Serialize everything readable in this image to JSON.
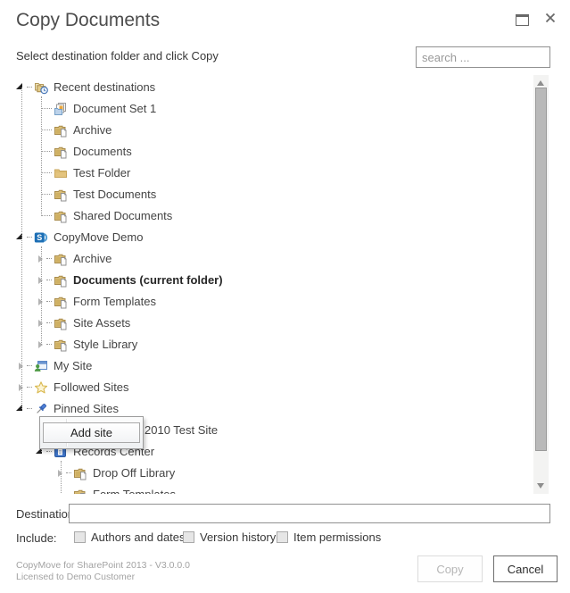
{
  "window": {
    "title": "Copy Documents",
    "controls": [
      {
        "name": "maximize",
        "icon": "maximize-icon"
      },
      {
        "name": "close",
        "icon": "close-icon"
      }
    ]
  },
  "instruction": "Select destination folder and click Copy",
  "search": {
    "placeholder": "search ..."
  },
  "tree": {
    "items": [
      {
        "label": "Recent destinations",
        "level": 0,
        "icon": "recent-destinations",
        "glyph": "expanded"
      },
      {
        "label": "Document Set 1",
        "level": 1,
        "icon": "document-set",
        "glyph": "none"
      },
      {
        "label": "Archive",
        "level": 1,
        "icon": "document-library",
        "glyph": "none"
      },
      {
        "label": "Documents",
        "level": 1,
        "icon": "document-library",
        "glyph": "none"
      },
      {
        "label": "Test Folder",
        "level": 1,
        "icon": "folder",
        "glyph": "none"
      },
      {
        "label": "Test Documents",
        "level": 1,
        "icon": "document-library",
        "glyph": "none"
      },
      {
        "label": "Shared Documents",
        "level": 1,
        "icon": "document-library",
        "glyph": "none"
      },
      {
        "label": "CopyMove Demo",
        "level": 0,
        "icon": "sharepoint-site",
        "glyph": "expanded"
      },
      {
        "label": "Archive",
        "level": 1,
        "icon": "document-library",
        "glyph": "collapsed"
      },
      {
        "label": "Documents (current folder)",
        "level": 1,
        "icon": "document-library",
        "glyph": "collapsed",
        "bold": true
      },
      {
        "label": "Form Templates",
        "level": 1,
        "icon": "document-library",
        "glyph": "collapsed"
      },
      {
        "label": "Site Assets",
        "level": 1,
        "icon": "document-library",
        "glyph": "collapsed"
      },
      {
        "label": "Style Library",
        "level": 1,
        "icon": "document-library",
        "glyph": "collapsed"
      },
      {
        "label": "My Site",
        "level": 0,
        "icon": "my-site",
        "glyph": "collapsed"
      },
      {
        "label": "Followed Sites",
        "level": 0,
        "icon": "followed-sites",
        "glyph": "collapsed"
      },
      {
        "label": "Pinned Sites",
        "level": 0,
        "icon": "pinned-sites",
        "glyph": "expanded"
      },
      {
        "label": "2010 Test Site",
        "level": 1,
        "icon": "none",
        "glyph": "none",
        "text_left": 162
      },
      {
        "label": "Records Center",
        "level": 1,
        "icon": "records-center",
        "glyph": "expanded"
      },
      {
        "label": "Drop Off Library",
        "level": 2,
        "icon": "document-library",
        "glyph": "collapsed"
      },
      {
        "label": "Form Templates",
        "level": 2,
        "icon": "document-library",
        "glyph": "none"
      }
    ]
  },
  "context_menu": {
    "items": [
      {
        "label": "Add site"
      }
    ]
  },
  "destination": {
    "label": "Destination:",
    "value": ""
  },
  "include": {
    "label": "Include:",
    "options": [
      {
        "label": "Authors and dates",
        "checked": false
      },
      {
        "label": "Version history",
        "checked": false
      },
      {
        "label": "Item permissions",
        "checked": false
      }
    ]
  },
  "footer": {
    "product": "CopyMove for SharePoint 2013 - V3.0.0.0",
    "license": "Licensed to Demo Customer"
  },
  "actions": {
    "copy": {
      "label": "Copy",
      "enabled": false
    },
    "cancel": {
      "label": "Cancel",
      "enabled": true
    }
  },
  "colors": {
    "sharepoint_blue": "#1d6fb5",
    "folder_tan": "#d9bd77",
    "tree_text": "#444444",
    "disabled_text": "#b6b6b6",
    "scrollbar_thumb": "#b9b9b9"
  }
}
